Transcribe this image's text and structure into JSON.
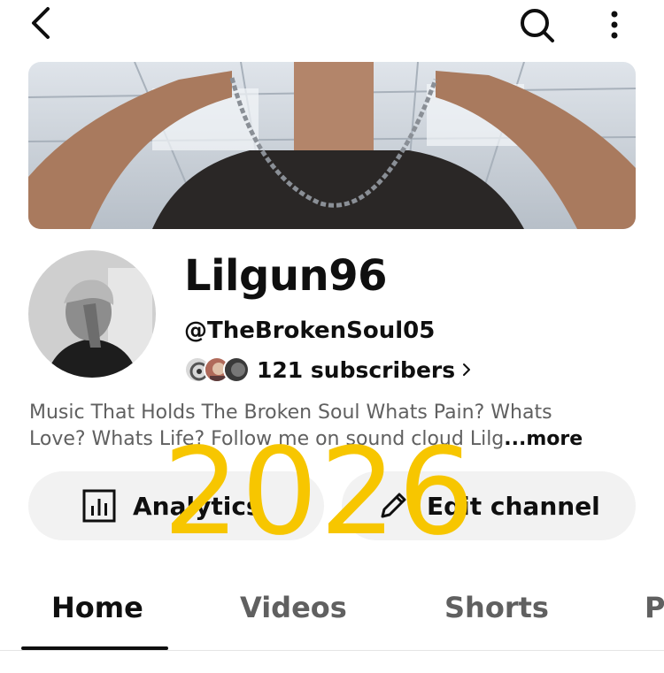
{
  "header": {
    "back_icon": "back-arrow-icon",
    "search_icon": "search-icon",
    "more_icon": "more-vertical-icon"
  },
  "channel": {
    "name": "Lilgun96",
    "handle": "@TheBrokenSoul05",
    "subscribers": "121 subscribers",
    "description_line1": "Music That Holds The Broken Soul Whats Pain? Whats",
    "description_line2": "Love? Whats Life? Follow me on sound cloud Lilg",
    "more_label": "...more"
  },
  "actions": {
    "analytics_label": "Analytics",
    "edit_label": "Edit channel"
  },
  "tabs": [
    "Home",
    "Videos",
    "Shorts",
    "P"
  ],
  "active_tab": "Home",
  "overlay_text": "2026",
  "colors": {
    "text_primary": "#0f0f0f",
    "text_secondary": "#606060",
    "button_bg": "#f2f2f2",
    "overlay": "#f7c600"
  }
}
